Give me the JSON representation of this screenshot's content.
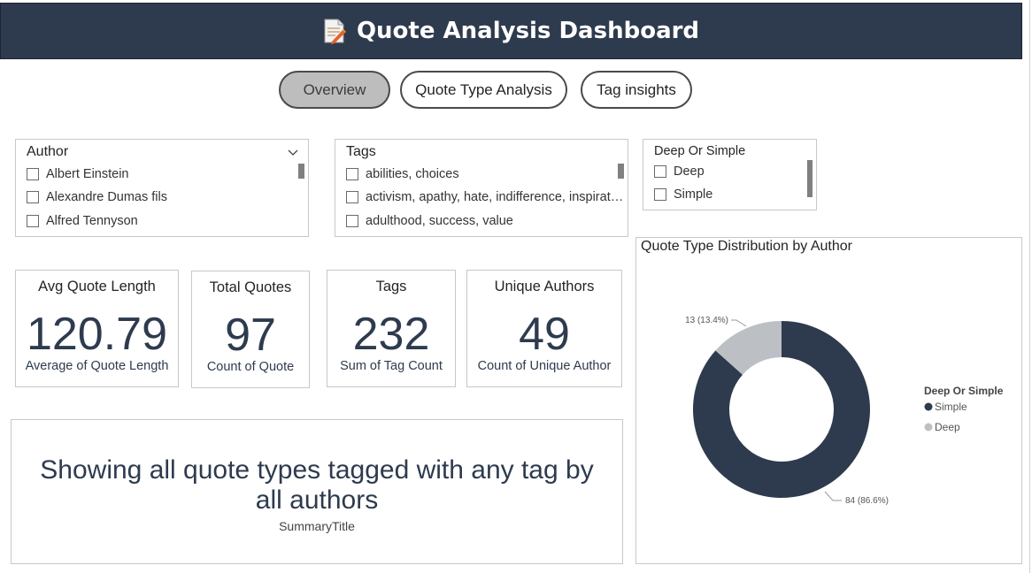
{
  "header": {
    "title": "Quote Analysis Dashboard",
    "icon": "memo-icon"
  },
  "nav": [
    {
      "label": "Overview",
      "active": true
    },
    {
      "label": "Quote Type Analysis",
      "active": false
    },
    {
      "label": "Tag insights",
      "active": false
    }
  ],
  "slicers": {
    "author": {
      "title": "Author",
      "items": [
        "Albert Einstein",
        "Alexandre Dumas fils",
        "Alfred Tennyson"
      ]
    },
    "tags": {
      "title": "Tags",
      "items": [
        "abilities, choices",
        "activism, apathy, hate, indifference, inspirat…",
        "adulthood, success, value"
      ]
    },
    "deep_simple": {
      "title": "Deep Or Simple",
      "items": [
        "Deep",
        "Simple"
      ]
    }
  },
  "cards": [
    {
      "title": "Avg Quote Length",
      "value": "120.79",
      "sub": "Average of Quote Length"
    },
    {
      "title": "Total Quotes",
      "value": "97",
      "sub": "Count of Quote"
    },
    {
      "title": "Tags",
      "value": "232",
      "sub": "Sum of Tag Count"
    },
    {
      "title": "Unique Authors",
      "value": "49",
      "sub": "Count of Unique Author"
    }
  ],
  "summary": {
    "text": "Showing all quote types tagged with any tag by all authors",
    "caption": "SummaryTitle"
  },
  "colors": {
    "header_bg": "#2e3b4e",
    "simple": "#2e3b4e",
    "deep": "#bcc0c4"
  },
  "chart_data": {
    "type": "pie",
    "title": "Quote Type Distribution by Author",
    "legend_title": "Deep Or Simple",
    "legend_position": "right",
    "slices": [
      {
        "name": "Simple",
        "value": 84,
        "label": "84 (86.6%)",
        "color": "#2e3b4e"
      },
      {
        "name": "Deep",
        "value": 13,
        "label": "13 (13.4%)",
        "color": "#bcc0c4"
      }
    ],
    "donut": true
  }
}
